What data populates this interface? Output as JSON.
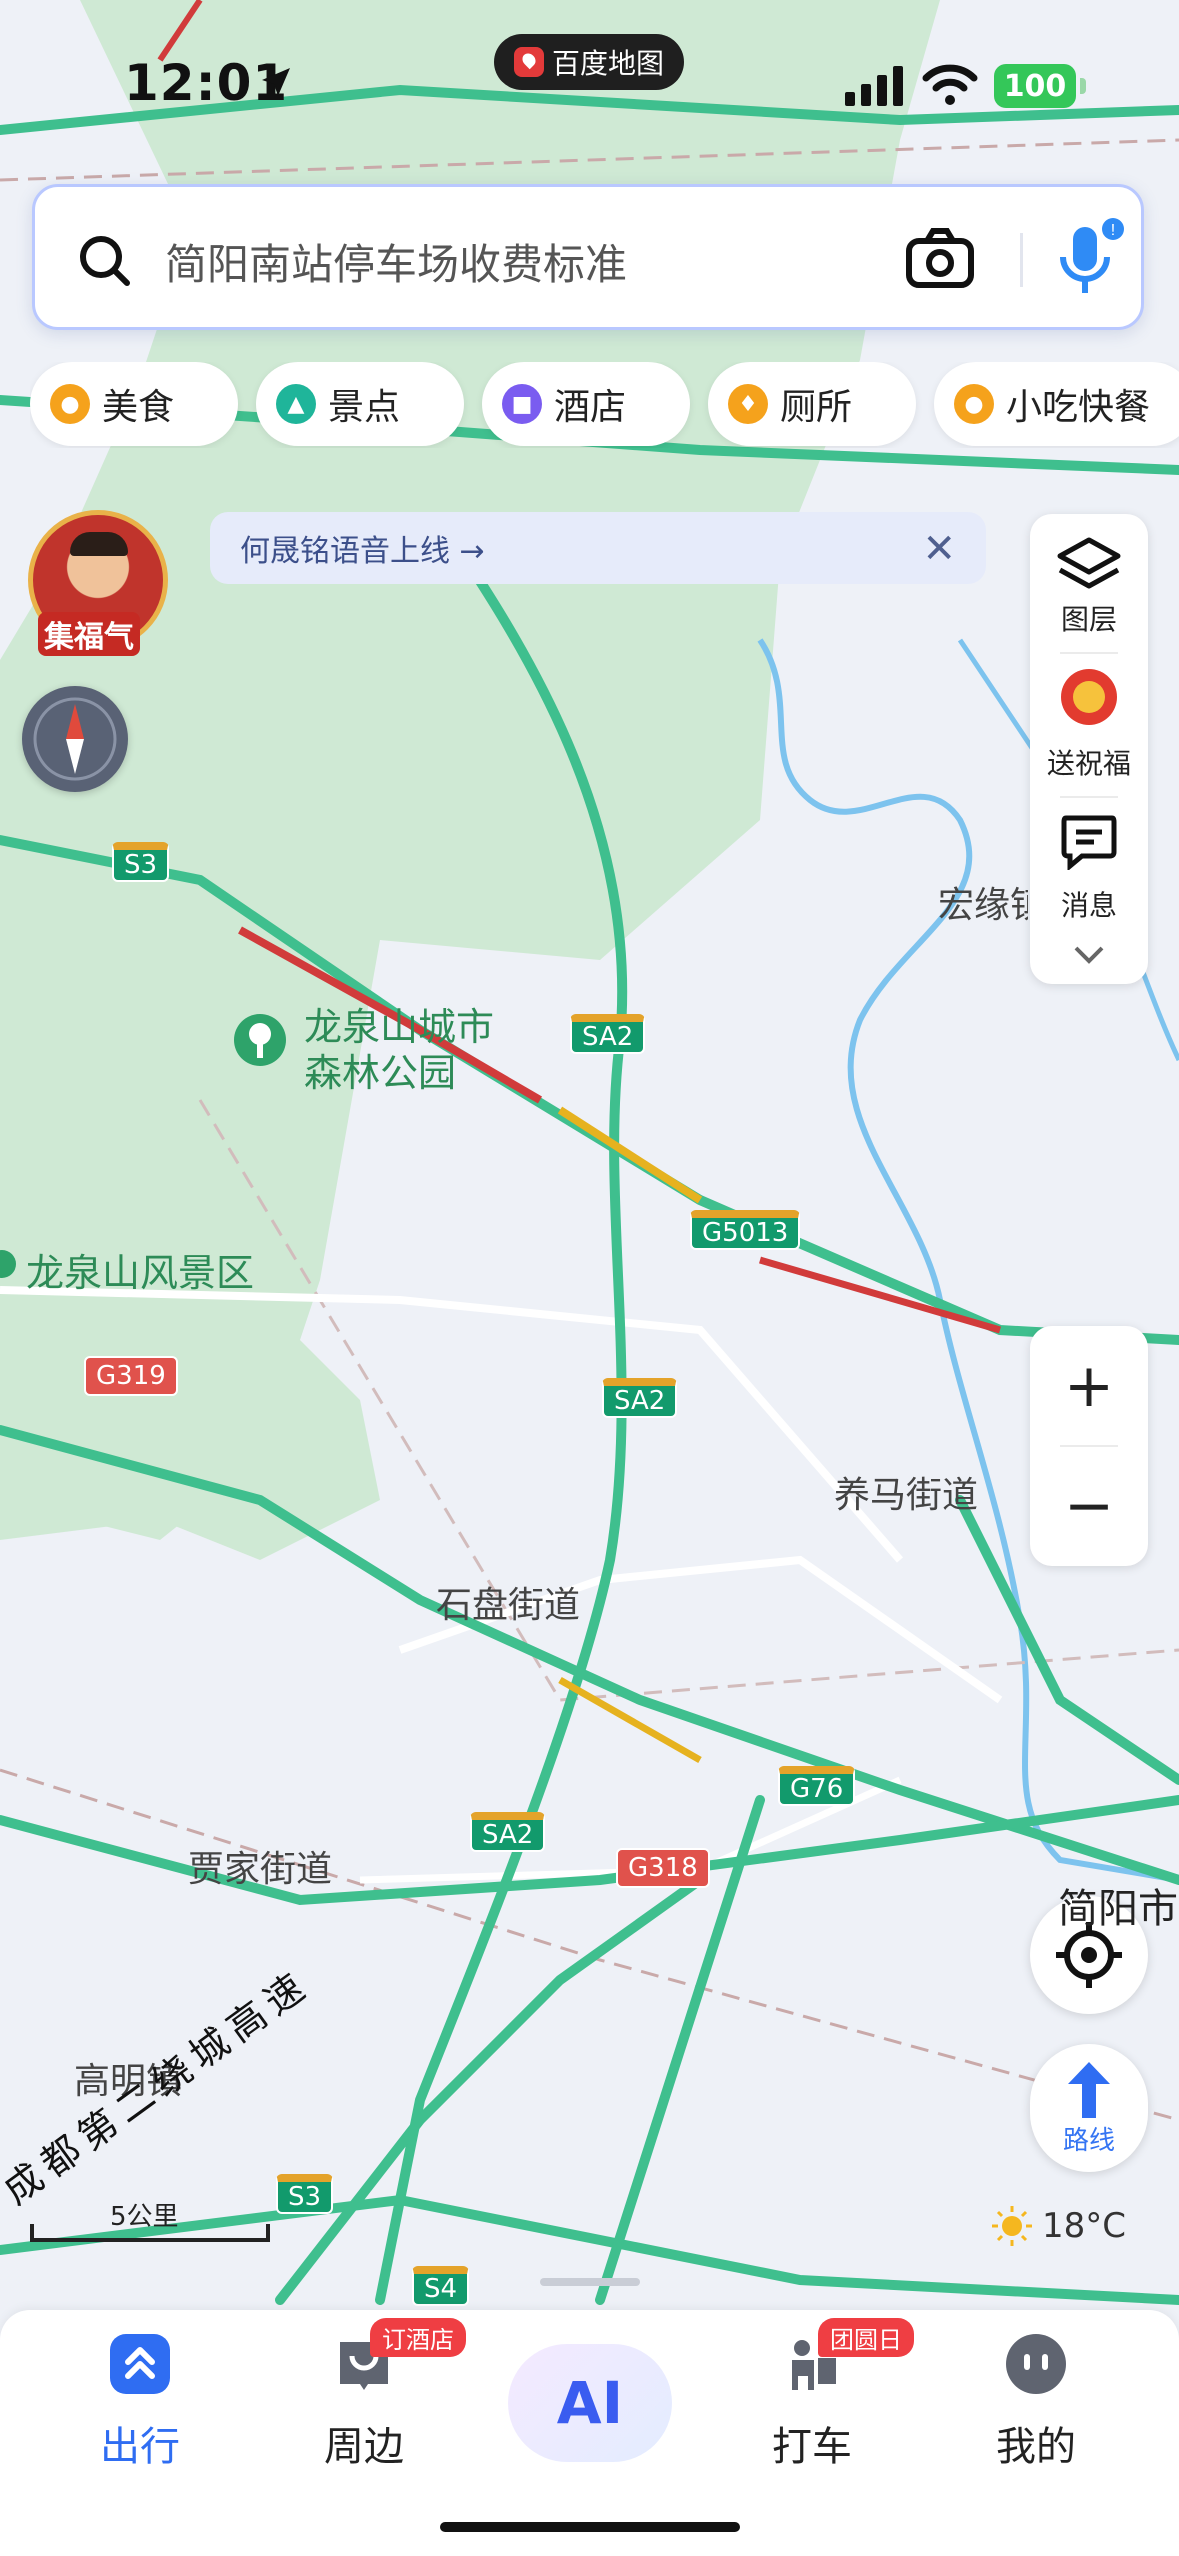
{
  "status_bar": {
    "time": "12:01",
    "app_pill": "百度地图",
    "battery": "100"
  },
  "search": {
    "placeholder": "简阳南站停车场收费标准"
  },
  "chips": [
    {
      "label": "美食",
      "icon": "food-icon",
      "color": "#f5a21c"
    },
    {
      "label": "景点",
      "icon": "scenery-icon",
      "color": "#1fb59a"
    },
    {
      "label": "酒店",
      "icon": "hotel-icon",
      "color": "#7a5cf0"
    },
    {
      "label": "厕所",
      "icon": "toilet-icon",
      "color": "#f5a21c"
    },
    {
      "label": "小吃快餐",
      "icon": "snack-icon",
      "color": "#f5a21c"
    }
  ],
  "promo": {
    "avatar_label": "集福气",
    "banner_text": "何晟铭语音上线 →"
  },
  "side_panel": {
    "layers": "图层",
    "blessing": "送祝福",
    "messages": "消息"
  },
  "map_labels": {
    "park": "龙泉山城市\n森林公园",
    "scenic": "龙泉山风景区",
    "yangma": "养马街道",
    "shipan": "石盘街道",
    "jiajia": "贾家街道",
    "gaoming": "高明镇",
    "hongyuan": "宏缘镇",
    "jianyang": "简阳市",
    "ring_expressway": "成都第二绕城高速"
  },
  "shields": {
    "s3_top": "S3",
    "sa2_1": "SA2",
    "g5013": "G5013",
    "g319": "G319",
    "sa2_2": "SA2",
    "g76": "G76",
    "sa2_3": "SA2",
    "g318": "G318",
    "s3_bottom": "S3",
    "s4": "S4"
  },
  "scale": "5公里",
  "weather": "18°C",
  "route_label": "路线",
  "bottom_nav": [
    {
      "label": "出行",
      "active": true
    },
    {
      "label": "周边",
      "badge": "订酒店"
    },
    {
      "label": "AI"
    },
    {
      "label": "打车",
      "badge": "团圆日"
    },
    {
      "label": "我的"
    }
  ],
  "colors": {
    "road": "#3fbf8e",
    "forest": "#cfe9d4",
    "river": "#7dc3ee",
    "accent": "#2f6df2"
  }
}
